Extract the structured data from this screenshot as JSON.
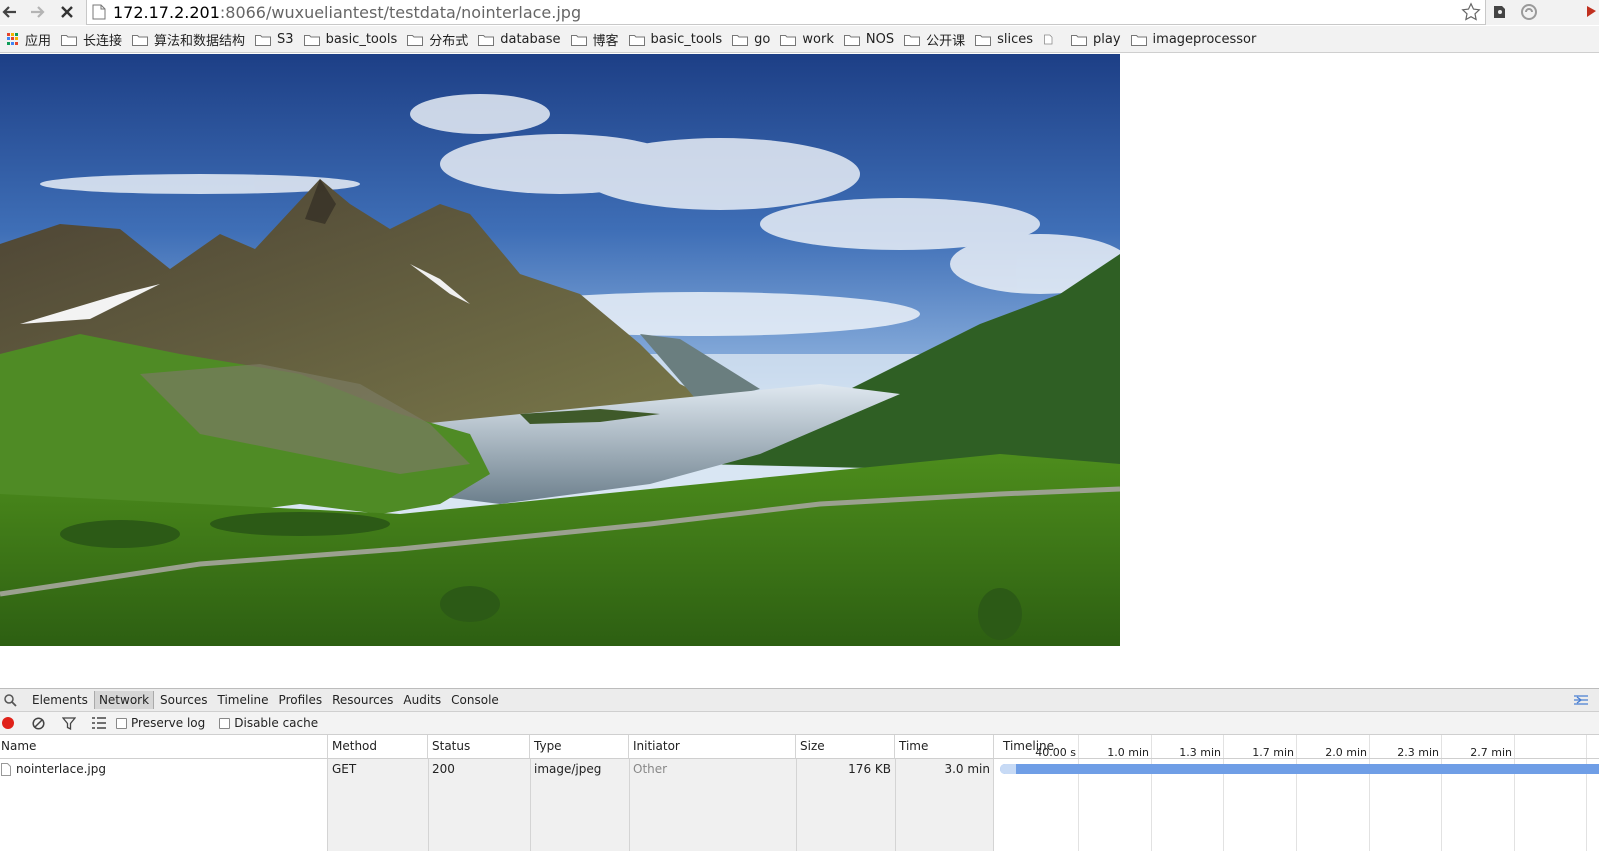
{
  "browser": {
    "url_host": "172.17.2.201",
    "url_rest": ":8066/wuxueliantest/testdata/nointerlace.jpg"
  },
  "bookmarks": [
    {
      "label": "应用",
      "type": "apps"
    },
    {
      "label": "长连接",
      "type": "folder"
    },
    {
      "label": "算法和数据结构",
      "type": "folder"
    },
    {
      "label": "S3",
      "type": "folder"
    },
    {
      "label": "basic_tools",
      "type": "folder"
    },
    {
      "label": "分布式",
      "type": "folder"
    },
    {
      "label": "database",
      "type": "folder"
    },
    {
      "label": "博客",
      "type": "folder"
    },
    {
      "label": "basic_tools",
      "type": "folder"
    },
    {
      "label": "go",
      "type": "folder"
    },
    {
      "label": "work",
      "type": "folder"
    },
    {
      "label": "NOS",
      "type": "folder"
    },
    {
      "label": "公开课",
      "type": "folder"
    },
    {
      "label": "slices",
      "type": "folder"
    },
    {
      "label": "",
      "type": "page"
    },
    {
      "label": "play",
      "type": "folder"
    },
    {
      "label": "imageprocessor",
      "type": "folder"
    }
  ],
  "devtools": {
    "tabs": [
      "Elements",
      "Network",
      "Sources",
      "Timeline",
      "Profiles",
      "Resources",
      "Audits",
      "Console"
    ],
    "active_tab": "Network",
    "preserve_log": "Preserve log",
    "disable_cache": "Disable cache",
    "columns": {
      "name": "Name",
      "method": "Method",
      "status": "Status",
      "type": "Type",
      "initiator": "Initiator",
      "size": "Size",
      "time": "Time",
      "timeline": "Timeline"
    },
    "timeline_ticks": [
      "40.00 s",
      "1.0 min",
      "1.3 min",
      "1.7 min",
      "2.0 min",
      "2.3 min",
      "2.7 min"
    ],
    "request": {
      "name": "nointerlace.jpg",
      "method": "GET",
      "status": "200",
      "type": "image/jpeg",
      "initiator": "Other",
      "size": "176 KB",
      "time": "3.0 min"
    }
  },
  "colors": {
    "record": "#e0221a",
    "timeline_bar": "#6f9ee6",
    "accent_blue": "#3d7bd8"
  }
}
